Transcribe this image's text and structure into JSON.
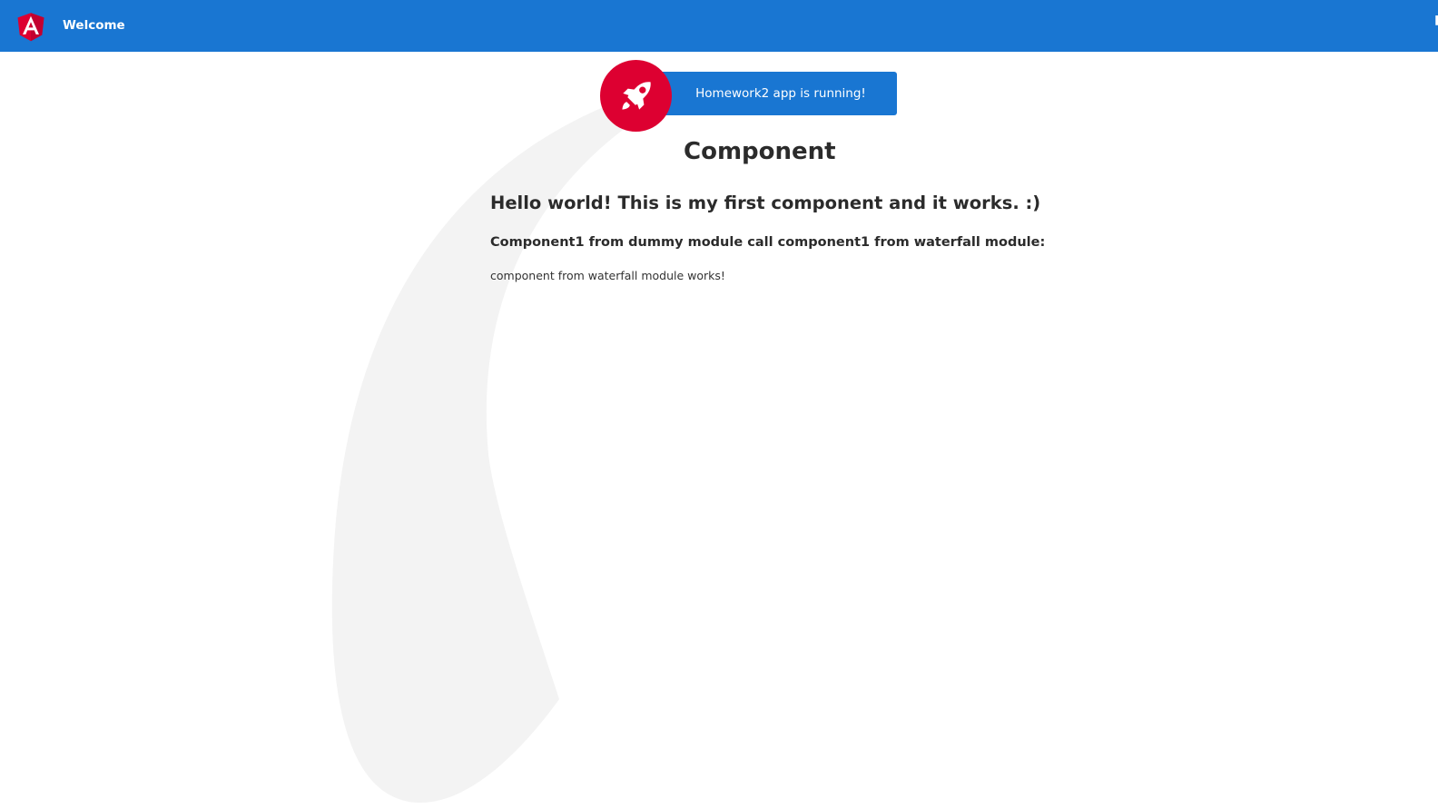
{
  "toolbar": {
    "logo_icon": "angular-logo-icon",
    "title": "Welcome",
    "background": "#1976d2"
  },
  "banner": {
    "icon": "rocket-icon",
    "text": "Homework2 app is running!",
    "accent": "#dd0031"
  },
  "main": {
    "title": "Component",
    "hello": "Hello world! This is my first component and it works. :)",
    "subheading": "Component1 from dummy module call component1 from waterfall module:",
    "waterfall_text": "component from waterfall module works!"
  }
}
